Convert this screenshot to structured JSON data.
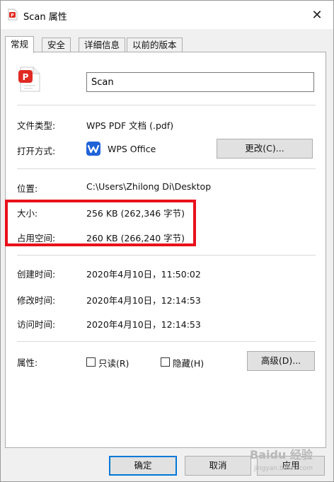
{
  "window": {
    "title": "Scan 属性",
    "close_glyph": "✕"
  },
  "tabs": [
    {
      "label": "常规",
      "active": true
    },
    {
      "label": "安全",
      "active": false
    },
    {
      "label": "详细信息",
      "active": false
    },
    {
      "label": "以前的版本",
      "active": false
    }
  ],
  "general": {
    "file_name": "Scan",
    "file_type": {
      "label": "文件类型:",
      "value": "WPS PDF 文档 (.pdf)"
    },
    "opens_with": {
      "label": "打开方式:",
      "app": "WPS Office",
      "change_button": "更改(C)..."
    },
    "location": {
      "label": "位置:",
      "value": "C:\\Users\\Zhilong Di\\Desktop"
    },
    "size": {
      "label": "大小:",
      "value": "256 KB (262,346 字节)"
    },
    "size_on_disk": {
      "label": "占用空间:",
      "value": "260 KB (266,240 字节)"
    },
    "created": {
      "label": "创建时间:",
      "value": "2020年4月10日，11:50:02"
    },
    "modified": {
      "label": "修改时间:",
      "value": "2020年4月10日，12:14:53"
    },
    "accessed": {
      "label": "访问时间:",
      "value": "2020年4月10日，12:14:53"
    },
    "attributes": {
      "label": "属性:",
      "readonly": {
        "label": "只读(R)",
        "checked": false
      },
      "hidden": {
        "label": "隐藏(H)",
        "checked": false
      },
      "advanced_button": "高级(D)..."
    }
  },
  "footer": {
    "ok": "确定",
    "cancel": "取消",
    "apply": "应用"
  },
  "watermark": {
    "logo": "Baidu 经验",
    "url": "jingyan.baidu.com"
  },
  "colors": {
    "highlight_box": "#e8101a",
    "pdf_icon": "#e02a23",
    "wps_icon": "#1f63d9",
    "primary_button_border": "#0078d7"
  },
  "icons": {
    "title": "pdf-file-icon",
    "file": "pdf-document-icon",
    "app": "wps-office-icon"
  }
}
